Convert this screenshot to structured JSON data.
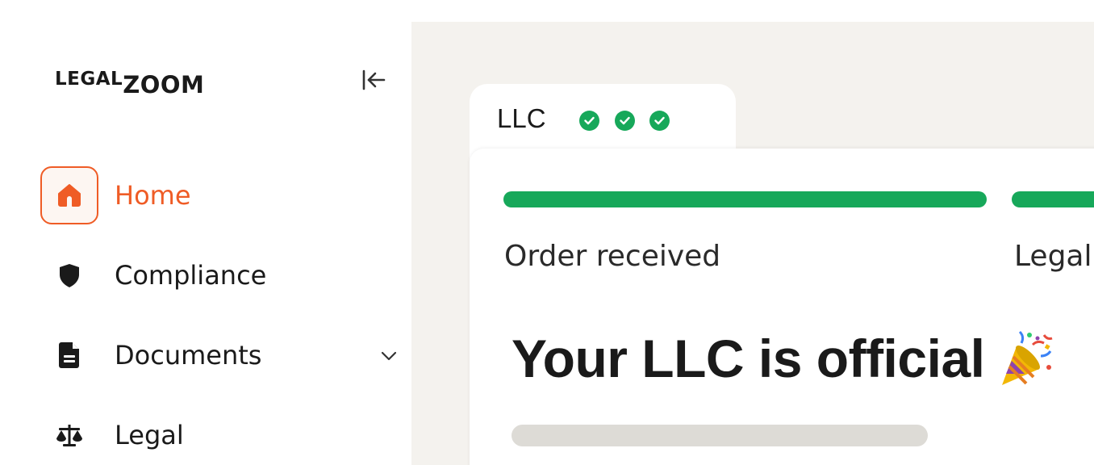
{
  "brand": {
    "logo_part1": "LEGAL",
    "logo_part2": "ZOOM"
  },
  "sidebar": {
    "collapse_icon": "collapse-left-icon",
    "items": [
      {
        "label": "Home",
        "icon": "home-icon",
        "active": true
      },
      {
        "label": "Compliance",
        "icon": "shield-icon",
        "active": false
      },
      {
        "label": "Documents",
        "icon": "document-icon",
        "active": false,
        "expandable": true
      },
      {
        "label": "Legal",
        "icon": "scales-icon",
        "active": false
      }
    ]
  },
  "order_tab": {
    "label": "LLC",
    "completed_checks": 3
  },
  "progress": {
    "steps": [
      {
        "label": "Order received",
        "complete": true
      },
      {
        "label": "Legal",
        "complete": true
      }
    ]
  },
  "headline": "Your LLC is official",
  "headline_emoji": "party-popper-icon",
  "colors": {
    "accent": "#ef5c26",
    "success": "#17a85a",
    "background": "#f4f2ee"
  }
}
